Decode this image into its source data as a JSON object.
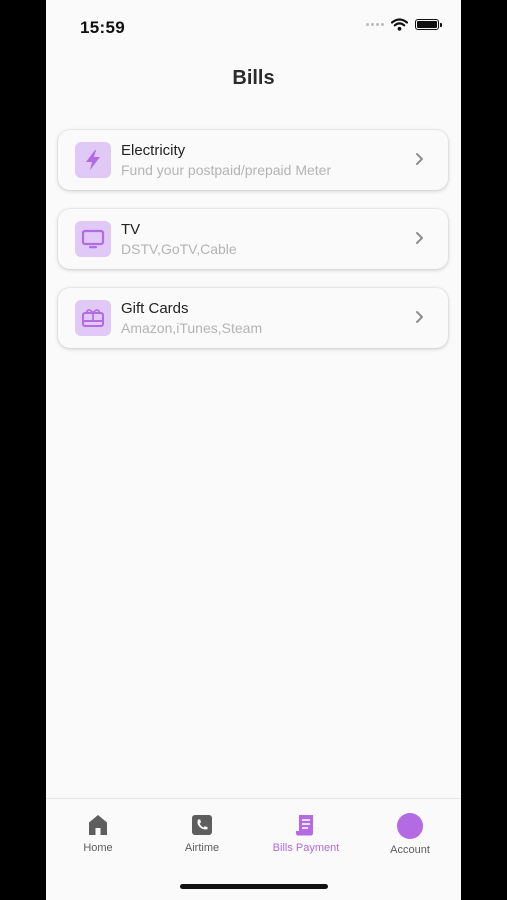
{
  "status_bar": {
    "time": "15:59"
  },
  "header": {
    "title": "Bills"
  },
  "bills": [
    {
      "title": "Electricity",
      "subtitle": "Fund your postpaid/prepaid Meter",
      "icon": "lightning-icon"
    },
    {
      "title": "TV",
      "subtitle": "DSTV,GoTV,Cable",
      "icon": "tv-icon"
    },
    {
      "title": "Gift Cards",
      "subtitle": "Amazon,iTunes,Steam",
      "icon": "gift-card-icon"
    }
  ],
  "tabs": [
    {
      "label": "Home",
      "icon": "home-icon"
    },
    {
      "label": "Airtime",
      "icon": "phone-icon"
    },
    {
      "label": "Bills Payment",
      "icon": "receipt-icon",
      "active": true
    },
    {
      "label": "Account",
      "icon": "avatar"
    }
  ],
  "colors": {
    "accent": "#b36ae2",
    "icon_bg": "#e0c9f7",
    "background": "#fafafa"
  }
}
